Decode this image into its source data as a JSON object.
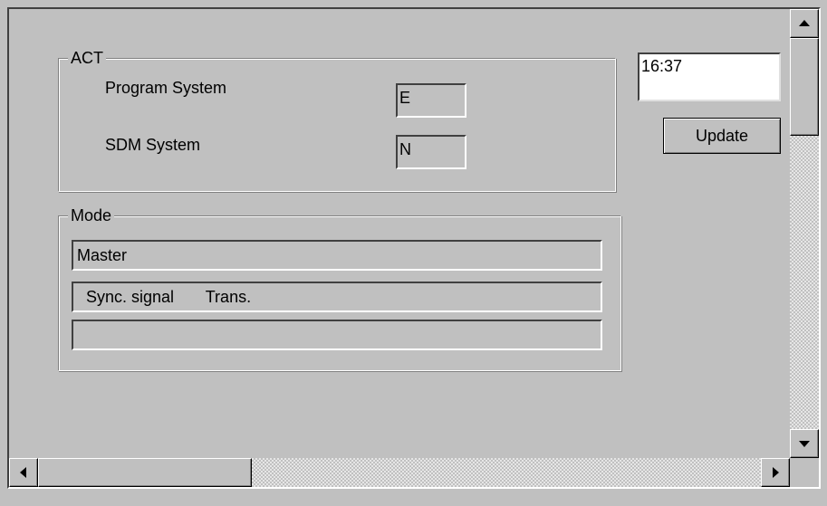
{
  "act_group": {
    "legend": "ACT",
    "rows": [
      {
        "label": "Program System",
        "value": "E"
      },
      {
        "label": "SDM System",
        "value": "N"
      }
    ]
  },
  "mode_group": {
    "legend": "Mode",
    "fields": [
      "Master",
      "  Sync. signal       Trans.",
      ""
    ]
  },
  "time_box": {
    "value": "16:37"
  },
  "update_button": {
    "label": "Update"
  },
  "icons": {
    "scroll_up": "arrow-up-icon",
    "scroll_down": "arrow-down-icon",
    "scroll_left": "arrow-left-icon",
    "scroll_right": "arrow-right-icon"
  },
  "colors": {
    "face": "#c0c0c0",
    "shadow": "#808080",
    "dark_shadow": "#404040",
    "highlight": "#ffffff",
    "edit_background": "#ffffff"
  }
}
